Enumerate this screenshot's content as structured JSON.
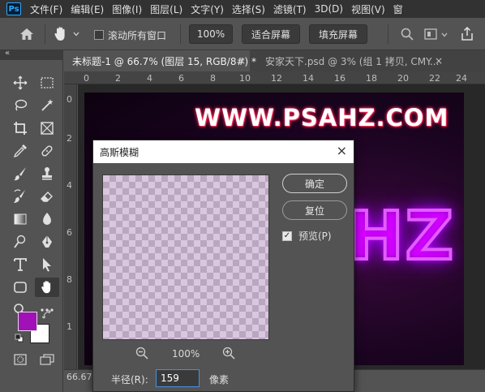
{
  "menubar": {
    "logo": "Ps",
    "items": [
      "文件(F)",
      "编辑(E)",
      "图像(I)",
      "图层(L)",
      "文字(Y)",
      "选择(S)",
      "滤镜(T)",
      "3D(D)",
      "视图(V)",
      "窗"
    ]
  },
  "options": {
    "scroll_all_windows": "滚动所有窗口",
    "zoom": "100%",
    "fit_screen": "适合屏幕",
    "fill_screen": "填充屏幕"
  },
  "tabs": [
    {
      "label": "未标题-1 @ 66.7% (图层 15, RGB/8#) *",
      "close": "×"
    },
    {
      "label": "安家天下.psd @ 3% (组 1 拷贝, CMY...",
      "close": "×"
    }
  ],
  "ruler": {
    "h_ticks": [
      "0",
      "2",
      "4",
      "6",
      "8",
      "10",
      "12",
      "14",
      "16",
      "18",
      "20",
      "22",
      "24"
    ],
    "v_ticks": [
      "0",
      "2",
      "4",
      "6",
      "8",
      "1"
    ]
  },
  "canvas": {
    "site_text": "WWW.PSAHZ.COM",
    "neon_text": "HZ"
  },
  "status": {
    "zoom": "66.67"
  },
  "dialog": {
    "title": "高斯模糊",
    "close": "×",
    "ok": "确定",
    "reset": "复位",
    "preview_label": "预览(P)",
    "preview_checked": true,
    "zoom_pct": "100%",
    "radius_label": "半径(R):",
    "radius_value": "159",
    "unit": "像素"
  },
  "colors": {
    "foreground": "#a210b8",
    "background": "#ffffff",
    "accent": "#31a8ff"
  }
}
